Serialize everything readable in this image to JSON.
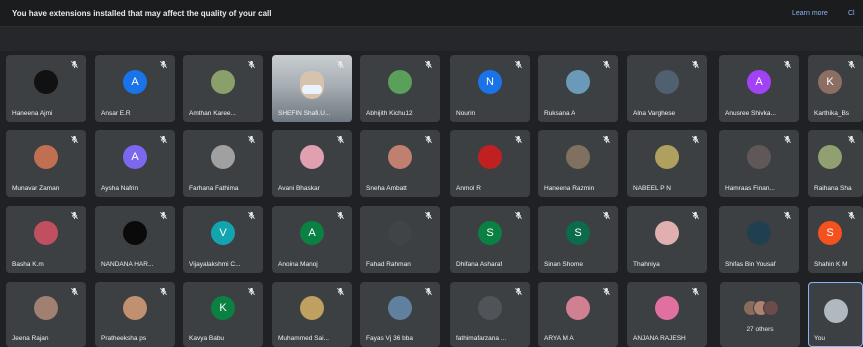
{
  "banner": {
    "message": "You have extensions installed that may affect the quality of your call",
    "learn_more": "Learn more",
    "close": "Cl"
  },
  "participants": [
    {
      "name": "Haneena Ajmi",
      "avatar": "photo",
      "color": "#111111",
      "mic": "muted"
    },
    {
      "name": "Ansar E.R",
      "avatar": "letter",
      "letter": "A",
      "color": "#1a73e8",
      "mic": "muted"
    },
    {
      "name": "Amthan Karee...",
      "avatar": "photo",
      "color": "#8aa06a",
      "mic": "muted"
    },
    {
      "name": "SHEFIN Shafi.U...",
      "avatar": "video",
      "color": "#b8c2c8",
      "mic": "muted"
    },
    {
      "name": "Abhijith Kichu12",
      "avatar": "photo",
      "color": "#5aa05a",
      "mic": "muted"
    },
    {
      "name": "Nourin",
      "avatar": "letter",
      "letter": "N",
      "color": "#1a73e8",
      "mic": "muted"
    },
    {
      "name": "Ruksana A",
      "avatar": "photo",
      "color": "#6a9ab8",
      "mic": "muted"
    },
    {
      "name": "Alna Varghese",
      "avatar": "photo",
      "color": "#506070",
      "mic": "muted"
    },
    {
      "name": "Anusree Shivka...",
      "avatar": "letter",
      "letter": "A",
      "color": "#a142f4",
      "mic": "muted"
    },
    {
      "name": "Karthika_Bs",
      "avatar": "letter",
      "letter": "K",
      "color": "#8d6e63",
      "mic": "muted"
    },
    {
      "name": "Munavar Zaman",
      "avatar": "photo",
      "color": "#c07050",
      "mic": "muted"
    },
    {
      "name": "Aysha Nafrin",
      "avatar": "letter",
      "letter": "A",
      "color": "#7b68ee",
      "mic": "muted"
    },
    {
      "name": "Farhana Fathima",
      "avatar": "photo",
      "color": "#a0a0a0",
      "mic": "muted"
    },
    {
      "name": "Avani Bhaskar",
      "avatar": "photo",
      "color": "#e0a0b0",
      "mic": "muted"
    },
    {
      "name": "Sneha Ambatt",
      "avatar": "photo",
      "color": "#c08070",
      "mic": "muted"
    },
    {
      "name": "Anmol R",
      "avatar": "photo",
      "color": "#c02020",
      "mic": "muted"
    },
    {
      "name": "Haneena Razmin",
      "avatar": "photo",
      "color": "#807060",
      "mic": "muted"
    },
    {
      "name": "NABEEL P N",
      "avatar": "photo",
      "color": "#b0a060",
      "mic": "muted"
    },
    {
      "name": "Hamraas Finan...",
      "avatar": "photo",
      "color": "#605858",
      "mic": "muted"
    },
    {
      "name": "Raihana Sha",
      "avatar": "photo",
      "color": "#90a070",
      "mic": "muted"
    },
    {
      "name": "Basha K.m",
      "avatar": "photo",
      "color": "#c05060",
      "mic": "muted"
    },
    {
      "name": "NANDANA HAR...",
      "avatar": "photo",
      "color": "#0a0a0a",
      "mic": "muted"
    },
    {
      "name": "Vijayalakshmi C...",
      "avatar": "letter",
      "letter": "V",
      "color": "#12a4af",
      "mic": "muted"
    },
    {
      "name": "Anoina Manoj",
      "avatar": "letter",
      "letter": "A",
      "color": "#0b8043",
      "mic": "muted"
    },
    {
      "name": "Fahad Rahman",
      "avatar": "photo",
      "color": "#404448",
      "mic": "muted"
    },
    {
      "name": "Dhifana Asharaf",
      "avatar": "letter",
      "letter": "S",
      "color": "#0b8043",
      "mic": "muted"
    },
    {
      "name": "Sinan Shome",
      "avatar": "letter",
      "letter": "S",
      "color": "#0b6b4b",
      "mic": "muted"
    },
    {
      "name": "Thahniya",
      "avatar": "photo",
      "color": "#e0b0b0",
      "mic": "muted"
    },
    {
      "name": "Shifas Bin Yousaf",
      "avatar": "photo",
      "color": "#204050",
      "mic": "muted"
    },
    {
      "name": "Shahin K M",
      "avatar": "letter",
      "letter": "S",
      "color": "#f4511e",
      "mic": "muted"
    },
    {
      "name": "Jeena Rajan",
      "avatar": "photo",
      "color": "#a08070",
      "mic": "muted"
    },
    {
      "name": "Pratheeksha ps",
      "avatar": "photo",
      "color": "#c09070",
      "mic": "muted"
    },
    {
      "name": "Kavya Babu",
      "avatar": "letter",
      "letter": "K",
      "color": "#0b8043",
      "mic": "muted"
    },
    {
      "name": "Muhammed Sai...",
      "avatar": "photo",
      "color": "#c0a060",
      "mic": "muted"
    },
    {
      "name": "Fayas Vj 36 bba",
      "avatar": "photo",
      "color": "#6080a0",
      "mic": "muted"
    },
    {
      "name": "fathimafarzana ...",
      "avatar": "photo",
      "color": "#505458",
      "mic": "muted"
    },
    {
      "name": "ARYA M A",
      "avatar": "photo",
      "color": "#d08090",
      "mic": "muted"
    },
    {
      "name": "ANJANA RAJESH",
      "avatar": "photo",
      "color": "#e070a0",
      "mic": "muted"
    }
  ],
  "others_tile": {
    "label": "27 others"
  },
  "self_tile": {
    "name": "You"
  }
}
